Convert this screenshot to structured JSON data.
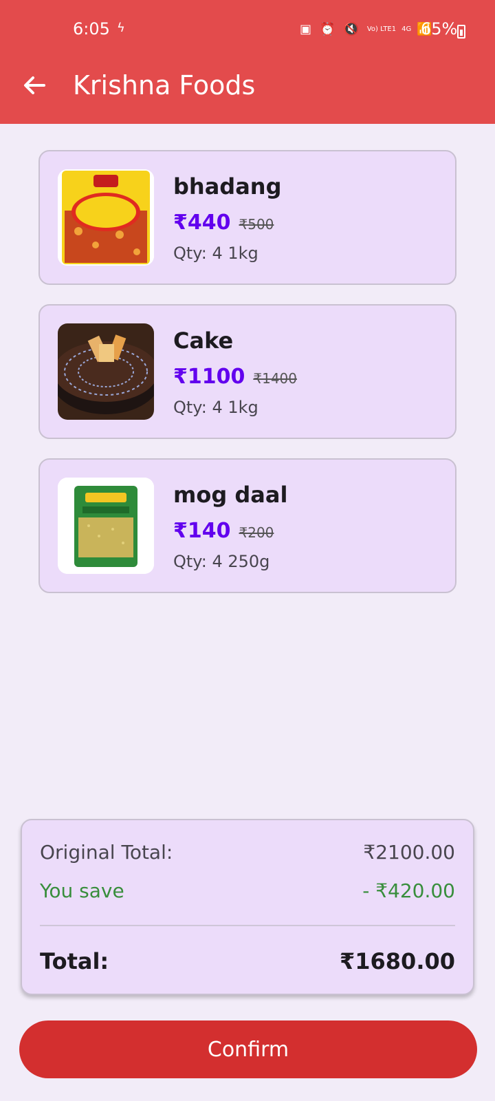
{
  "status_bar": {
    "time": "6:05",
    "time_icon": "ϟ",
    "network_small": "Vo) LTE1",
    "network_4g": "4G",
    "battery": "65%"
  },
  "appbar": {
    "title": "Krishna Foods",
    "back_icon": "arrow-left-icon"
  },
  "items": [
    {
      "name": "bhadang",
      "price": "₹440",
      "original_price": "₹500",
      "qty": "Qty: 4  1kg"
    },
    {
      "name": "Cake",
      "price": "₹1100",
      "original_price": "₹1400",
      "qty": "Qty: 4  1kg"
    },
    {
      "name": "mog daal",
      "price": "₹140",
      "original_price": "₹200",
      "qty": "Qty: 4  250g"
    }
  ],
  "summary": {
    "original_total_label": "Original Total:",
    "original_total_value": "₹2100.00",
    "you_save_label": "You save",
    "you_save_value": "- ₹420.00",
    "total_label": "Total:",
    "total_value": "₹1680.00"
  },
  "confirm_label": "Confirm",
  "colors": {
    "appbar": "#e34b4c",
    "accent_price": "#6200ee",
    "save_green": "#388e3c",
    "confirm": "#d32f2f"
  }
}
